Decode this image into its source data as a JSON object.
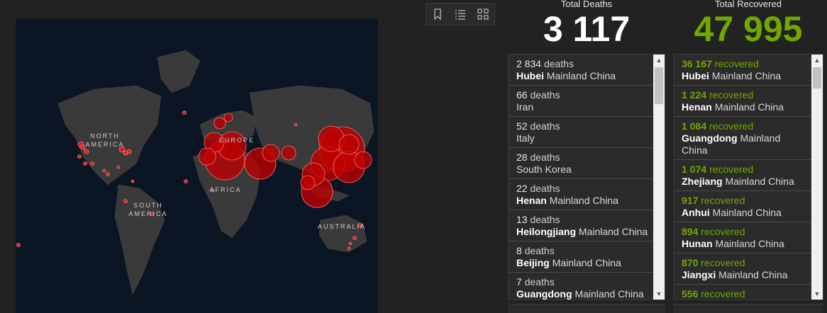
{
  "map": {
    "labels": {
      "north_america": "NORTH\nAMERICA",
      "europe": "EUROPE",
      "africa": "AFRICA",
      "south_america": "SOUTH\nAMERICA",
      "australia": "AUSTRALIA"
    },
    "toolbar": [
      "bookmark-icon",
      "list-icon",
      "qr-grid-icon"
    ],
    "colors": {
      "ocean": "#0b1523",
      "land": "#3a3a3a",
      "bubble": "#c00000",
      "bubble_edge": "#ff6b6b"
    }
  },
  "deaths": {
    "title": "Total Deaths",
    "value": "3 117",
    "items": [
      {
        "num": "2 834",
        "unit": "deaths",
        "place": "Hubei",
        "country": "Mainland China"
      },
      {
        "num": "66",
        "unit": "deaths",
        "place": "",
        "country": "Iran"
      },
      {
        "num": "52",
        "unit": "deaths",
        "place": "",
        "country": "Italy"
      },
      {
        "num": "28",
        "unit": "deaths",
        "place": "",
        "country": "South Korea"
      },
      {
        "num": "22",
        "unit": "deaths",
        "place": "Henan",
        "country": "Mainland China"
      },
      {
        "num": "13",
        "unit": "deaths",
        "place": "Heilongjiang",
        "country": "Mainland China"
      },
      {
        "num": "8",
        "unit": "deaths",
        "place": "Beijing",
        "country": "Mainland China"
      },
      {
        "num": "7",
        "unit": "deaths",
        "place": "Guangdong",
        "country": "Mainland China"
      }
    ]
  },
  "recovered": {
    "title": "Total Recovered",
    "value": "47 995",
    "items": [
      {
        "num": "36 167",
        "unit": "recovered",
        "place": "Hubei",
        "country": "Mainland China"
      },
      {
        "num": "1 224",
        "unit": "recovered",
        "place": "Henan",
        "country": "Mainland China"
      },
      {
        "num": "1 084",
        "unit": "recovered",
        "place": "Guangdong",
        "country": "Mainland China"
      },
      {
        "num": "1 074",
        "unit": "recovered",
        "place": "Zhejiang",
        "country": "Mainland China"
      },
      {
        "num": "917",
        "unit": "recovered",
        "place": "Anhui",
        "country": "Mainland China"
      },
      {
        "num": "894",
        "unit": "recovered",
        "place": "Hunan",
        "country": "Mainland China"
      },
      {
        "num": "870",
        "unit": "recovered",
        "place": "Jiangxi",
        "country": "Mainland China"
      },
      {
        "num": "556",
        "unit": "recovered",
        "place": "",
        "country": ""
      }
    ]
  },
  "scroll": {
    "up": "▲",
    "down": "▼"
  }
}
